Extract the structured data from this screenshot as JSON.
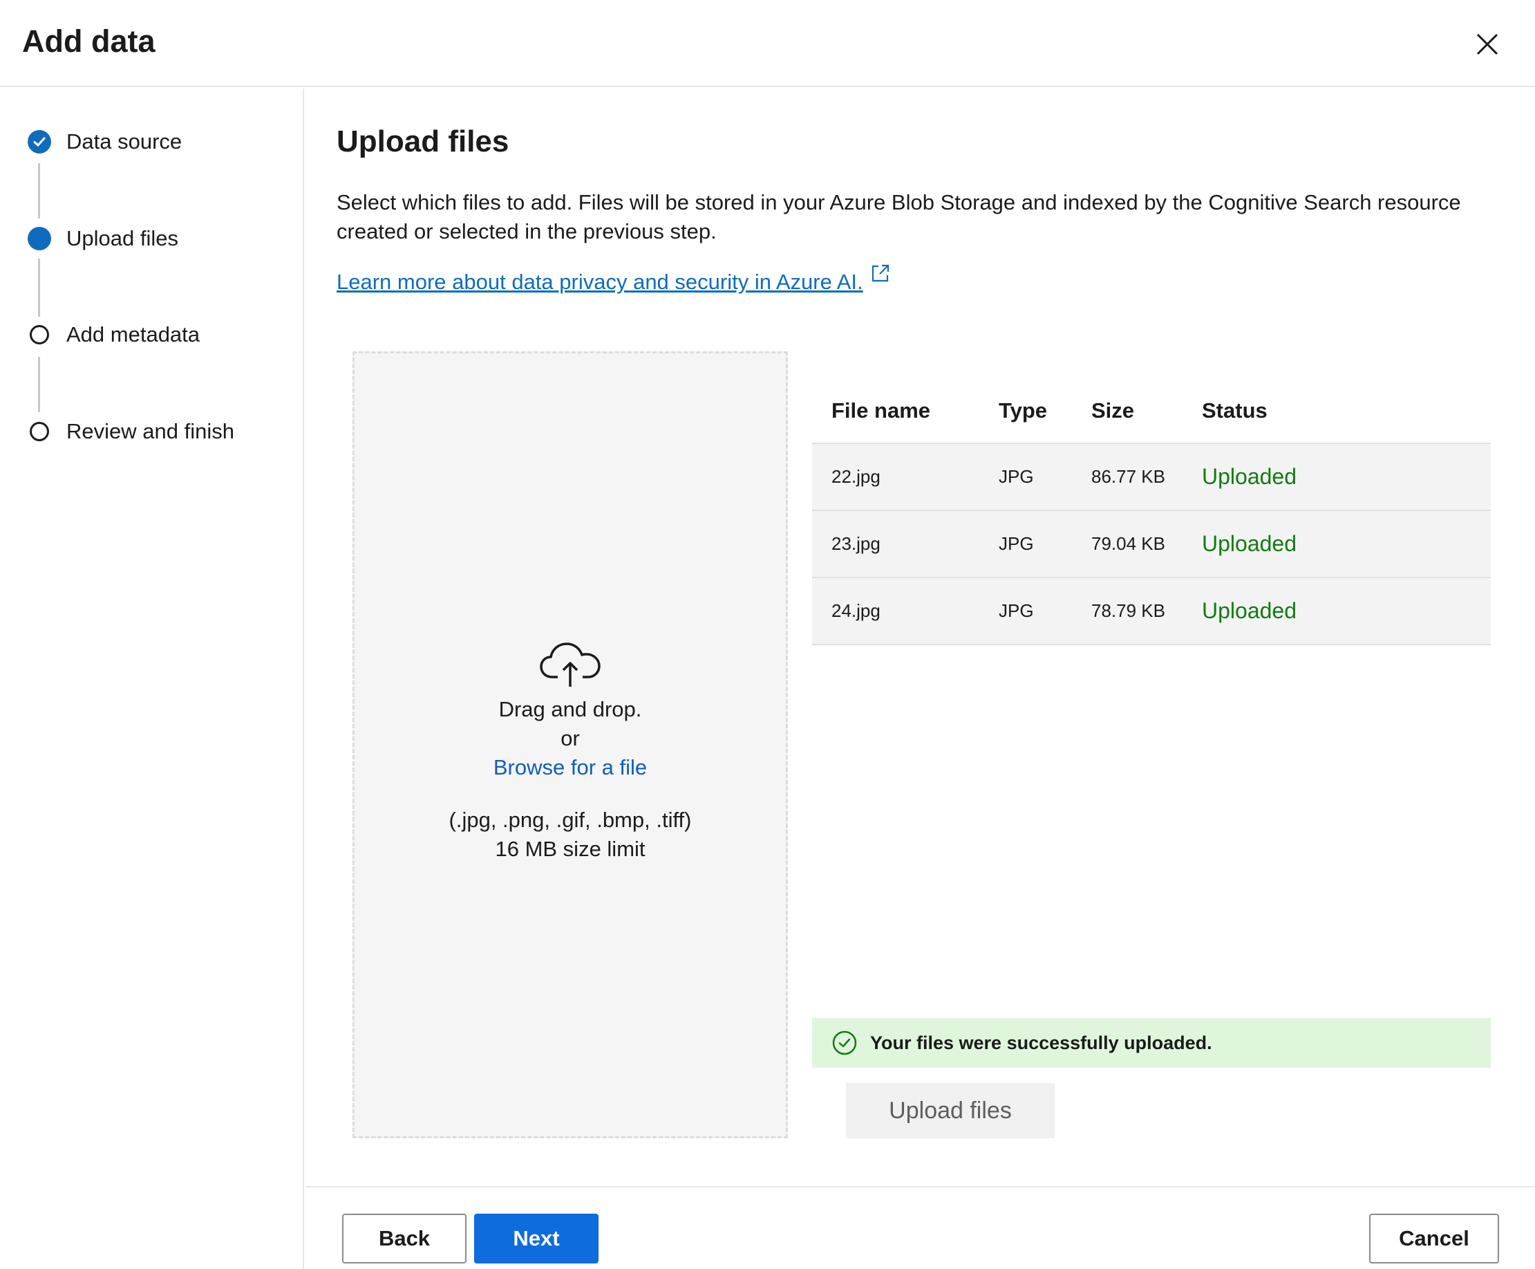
{
  "dialog": {
    "title": "Add data"
  },
  "steps": [
    {
      "label": "Data source",
      "state": "done"
    },
    {
      "label": "Upload files",
      "state": "current"
    },
    {
      "label": "Add metadata",
      "state": "todo"
    },
    {
      "label": "Review and finish",
      "state": "todo"
    }
  ],
  "main": {
    "title": "Upload files",
    "description": "Select which files to add. Files will be stored in your Azure Blob Storage and indexed by the Cognitive Search resource created or selected in the previous step.",
    "learn_more": "Learn more about data privacy and security in Azure AI."
  },
  "dropzone": {
    "drag_text": "Drag and drop.",
    "or_text": "or",
    "browse_text": "Browse for a file",
    "types_text": "(.jpg, .png, .gif, .bmp, .tiff)",
    "limit_text": "16 MB size limit"
  },
  "table": {
    "headers": {
      "name": "File name",
      "type": "Type",
      "size": "Size",
      "status": "Status"
    },
    "rows": [
      {
        "name": "22.jpg",
        "type": "JPG",
        "size": "86.77 KB",
        "status": "Uploaded"
      },
      {
        "name": "23.jpg",
        "type": "JPG",
        "size": "79.04 KB",
        "status": "Uploaded"
      },
      {
        "name": "24.jpg",
        "type": "JPG",
        "size": "78.79 KB",
        "status": "Uploaded"
      }
    ]
  },
  "banner": {
    "text": "Your files were successfully uploaded."
  },
  "upload_button": "Upload files",
  "footer": {
    "back": "Back",
    "next": "Next",
    "cancel": "Cancel"
  },
  "colors": {
    "accent": "#0f6cbd",
    "success": "#107c10",
    "success_bg": "#dff6dd"
  }
}
